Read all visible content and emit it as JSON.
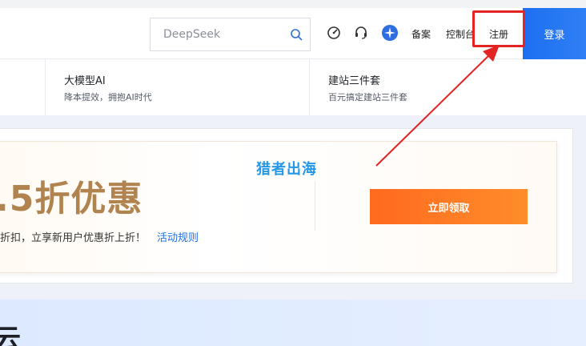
{
  "header": {
    "search": {
      "placeholder": "DeepSeek"
    },
    "links": {
      "beian": "备案",
      "console": "控制台",
      "register": "注册"
    },
    "login_label": "登录",
    "icons": [
      "dashboard-icon",
      "headset-icon",
      "brand-logo-icon",
      "search-icon"
    ]
  },
  "subnav": {
    "items": [
      {
        "title": "大模型AI",
        "desc": "降本提效，拥抱AI时代"
      },
      {
        "title": "建站三件套",
        "desc": "百元搞定建站三件套"
      }
    ]
  },
  "promo": {
    "headline": ".5折优惠",
    "subtitle": "折扣，立享新用户优惠折上折！",
    "rule_link": "活动规则",
    "claim_button": "立即领取",
    "watermark": "猎者出海"
  },
  "bottom": {
    "title_fragment": "云"
  },
  "colors": {
    "accent_blue": "#1e6ff0",
    "highlight_red": "#e32424",
    "promo_gold": "#b0834f",
    "cta_orange": "#ff7a22"
  }
}
